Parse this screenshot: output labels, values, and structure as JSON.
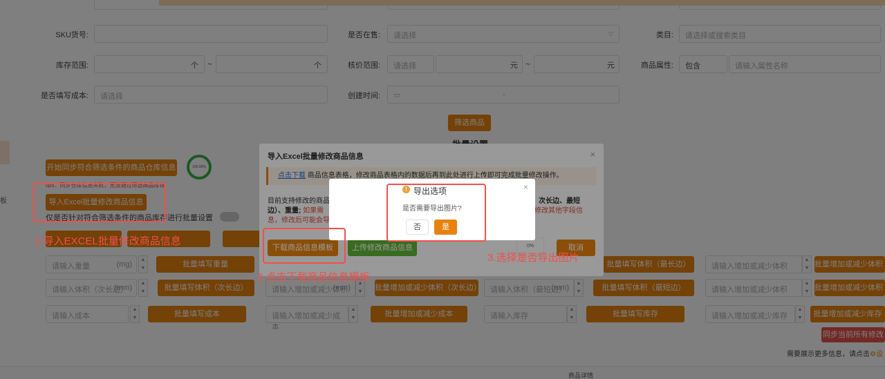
{
  "filters": {
    "sku_label": "SKU货号:",
    "in_stock_label": "是否在售:",
    "in_stock_placeholder": "请选择",
    "category_label": "类目:",
    "category_placeholder": "请选择或搜索类目",
    "stock_range_label": "库存范围:",
    "range_sep": "~",
    "sort_up": "个",
    "cost_range_label": "核价范围:",
    "cost_placeholder": "请选择",
    "currency": "元",
    "attr_label": "商品属性:",
    "attr_select": "包含",
    "attr_placeholder": "请输入属性名称",
    "fill_cost_label": "是否填写成本:",
    "fill_cost_placeholder": "请选择",
    "created_label": "创建时间:",
    "date_sep": "-",
    "filter_button": "筛选商品",
    "batch_title": "批量设置"
  },
  "left": {
    "sync_button": "开始同步符合筛选条件的商品仓库信息",
    "tip": "tips：同步仓库信息失败，无法通过筛选商品库存",
    "import_button": "导入Excel批量修改商品信息",
    "batch_switch_text": "仅是否针对符合筛选条件的商品库存进行批量设置"
  },
  "batch_rows": {
    "weight_placeholder": "请输入重量",
    "weight_unit": "(mg)",
    "weight_button": "批量填写重量",
    "volume_placeholder": "请输入体积（次长边）",
    "volume_unit": "(mm)",
    "volume_button": "批量填写体积（次长边）",
    "inc_volume_placeholder": "请输入增加或减少体积",
    "inc_volume_button": "批量增加或减少体积（次长边）",
    "vol_short_placeholder": "请输入体积（最短边）",
    "vol_short_button": "批量填写体积（最短边）",
    "vol_long_button": "批量填写体积（最长边）",
    "inc_long_placeholder": "请输入增加或减少体积",
    "inc_long_button": "批量增加或减少体积（最长边）",
    "inc_short_button": "批量增加或减少体积（最短边）",
    "cost_placeholder": "请输入成本",
    "cost_button": "批量填写成本",
    "inc_cost_placeholder": "请输入增加或减少成本",
    "inc_cost_button": "批量增加或减少成本",
    "stock_placeholder": "请输入库存",
    "stock_button": "批量填写库存",
    "inc_stock_placeholder": "请输入增加或减少库存",
    "inc_stock_button": "批量增加或减少库存",
    "sync_all_button": "同步当前所有修改",
    "more_info": "需要展示更多信息，请点击",
    "more_link": "设",
    "product_detail": "商品详情"
  },
  "import_dialog": {
    "title": "导入Excel批量修改商品信息",
    "notice_link": "点击下载",
    "notice_text": "商品信息表格，修改商品表格内的数据后再到此处进行上传即可完成批量修改操作。",
    "body_start": "目前支持修改的商品",
    "body_edges": "次长边、最短",
    "body_line2_start": "边）、重量;",
    "body_red1": "如果需",
    "body_red_right": "修改其他字段信",
    "body_line3": "息，修改后可能会导",
    "download_button": "下载商品信息模板",
    "upload_button": "上传修改商品信息",
    "progress": "0%",
    "cancel_button": "取消"
  },
  "export_dialog": {
    "title": "导出选项",
    "message": "是否需要导出图片?",
    "no_button": "否",
    "yes_button": "是"
  },
  "annotations": {
    "step1": "1.导入EXCEL批量修改商品信息",
    "step2": "2.点击下载商品信息模板",
    "step3": "3.选择是否导出图片"
  },
  "progress_circle": {
    "text": "100.00%",
    "value": 1.0
  },
  "colors": {
    "accent": "#e8820e",
    "green": "#5fb336",
    "annotation": "#f0504a"
  }
}
